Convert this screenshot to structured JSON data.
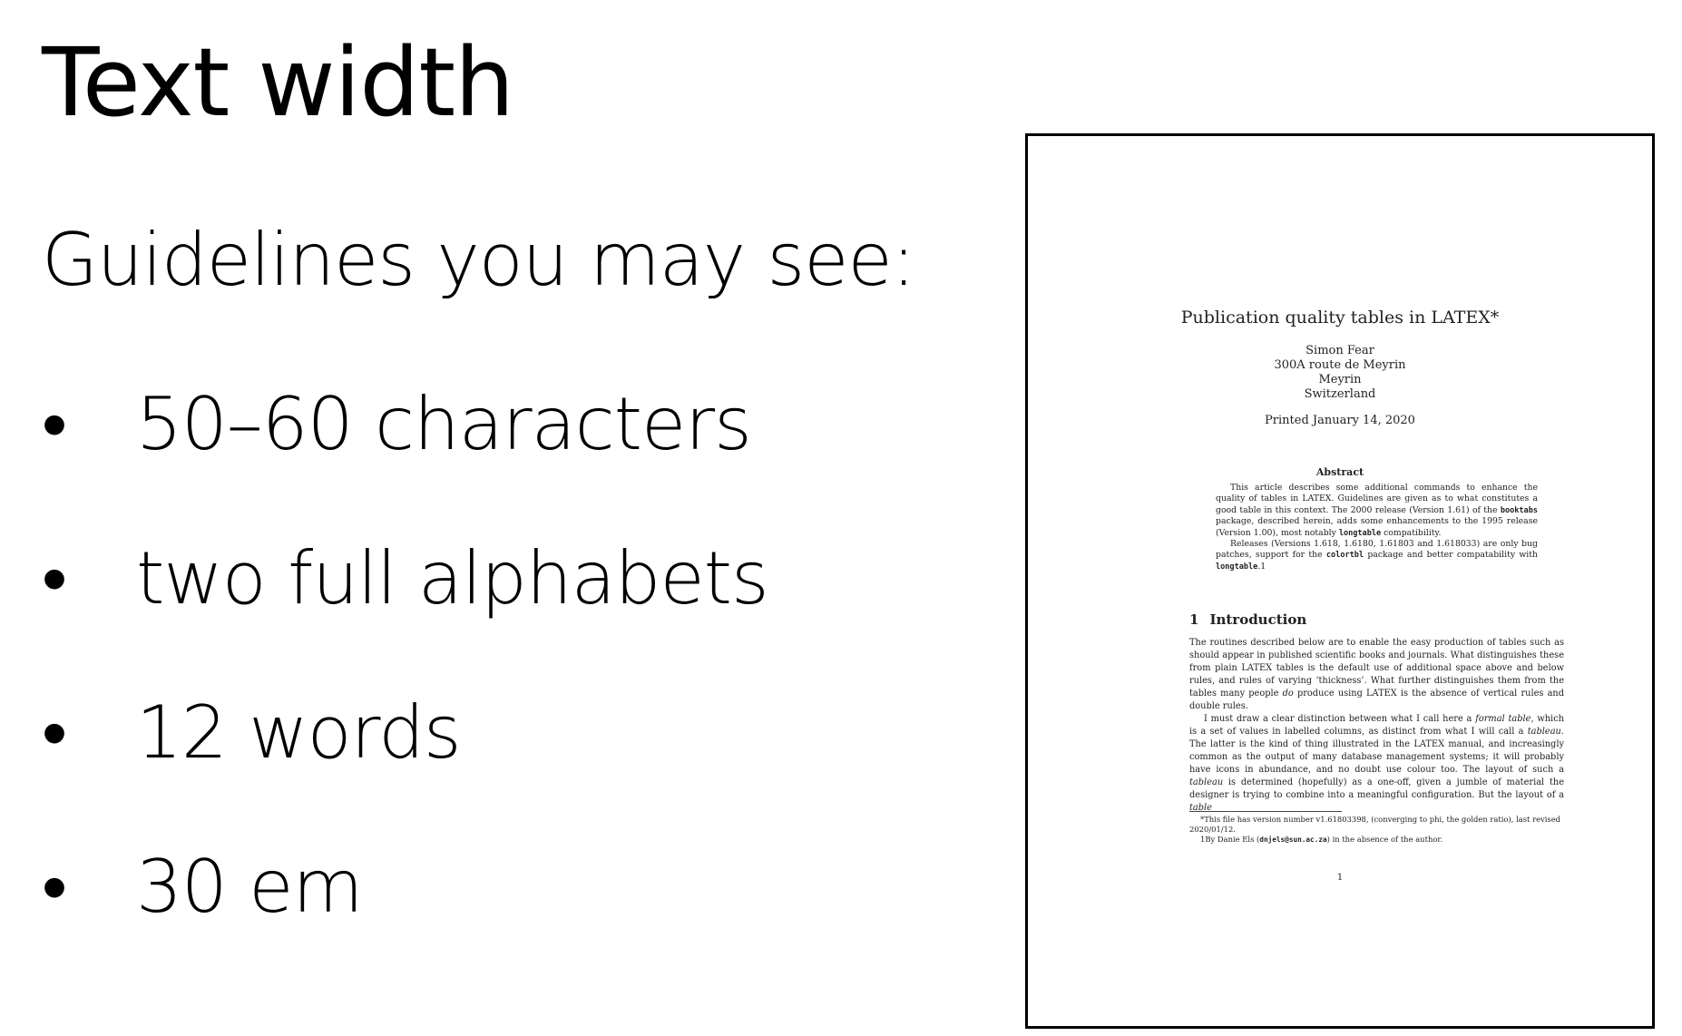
{
  "slide": {
    "title": "Text width",
    "subtitle": "Guidelines you may see:",
    "bullet_glyph": "•",
    "bullets": [
      "50–60 characters",
      "two full alphabets",
      "12 words",
      "30 em"
    ]
  },
  "document": {
    "title": "Publication quality tables in LATEX*",
    "author_lines": [
      "Simon Fear",
      "300A route de Meyrin",
      "Meyrin",
      "Switzerland"
    ],
    "date": "Printed January 14, 2020",
    "abstract_heading": "Abstract",
    "abstract_p1": [
      "This article describes some additional commands to enhance the quality of tables in LATEX. Guidelines are given as to what constitutes a good table in this context. The 2000 release (Version 1.61) of the ",
      "booktabs",
      " package, described herein, adds some enhancements to the 1995 release (Version 1.00), most notably ",
      "longtable",
      " compatibility."
    ],
    "abstract_p2": [
      "Releases (Versions 1.618, 1.6180, 1.61803 and 1.618033) are only bug patches, support for the ",
      "colortbl",
      " package and better compatability with ",
      "longtable",
      ".1"
    ],
    "section_number": "1",
    "section_title": "Introduction",
    "intro_p1": [
      "The routines described below are to enable the easy production of tables such as should appear in published scientific books and journals. What distinguishes these from plain LATEX tables is the default use of additional space above and below rules, and rules of varying ‘thickness’. What further distinguishes them from the tables many people ",
      "do",
      " produce using LATEX is the absence of vertical rules and double rules."
    ],
    "intro_p2": [
      "I must draw a clear distinction between what I call here a ",
      "formal table",
      ", which is a set of values in labelled columns, as distinct from what I will call a ",
      "tableau",
      ". The latter is the kind of thing illustrated in the LATEX manual, and increasingly common as the output of many database management systems; it will probably have icons in abundance, and no doubt use colour too. The layout of such a ",
      "tableau",
      " is determined (hopefully) as a one-off, given a jumble of material the designer is trying to combine into a meaningful configuration. But the layout of a ",
      "table"
    ],
    "footnote1": "*This file has version number v1.61803398, (converging to phi, the golden ratio), last revised 2020/01/12.",
    "footnote2": [
      "1By Danie Els (",
      "dnjels@sun.ac.za",
      ") in the absence of the author."
    ],
    "page_number": "1"
  }
}
